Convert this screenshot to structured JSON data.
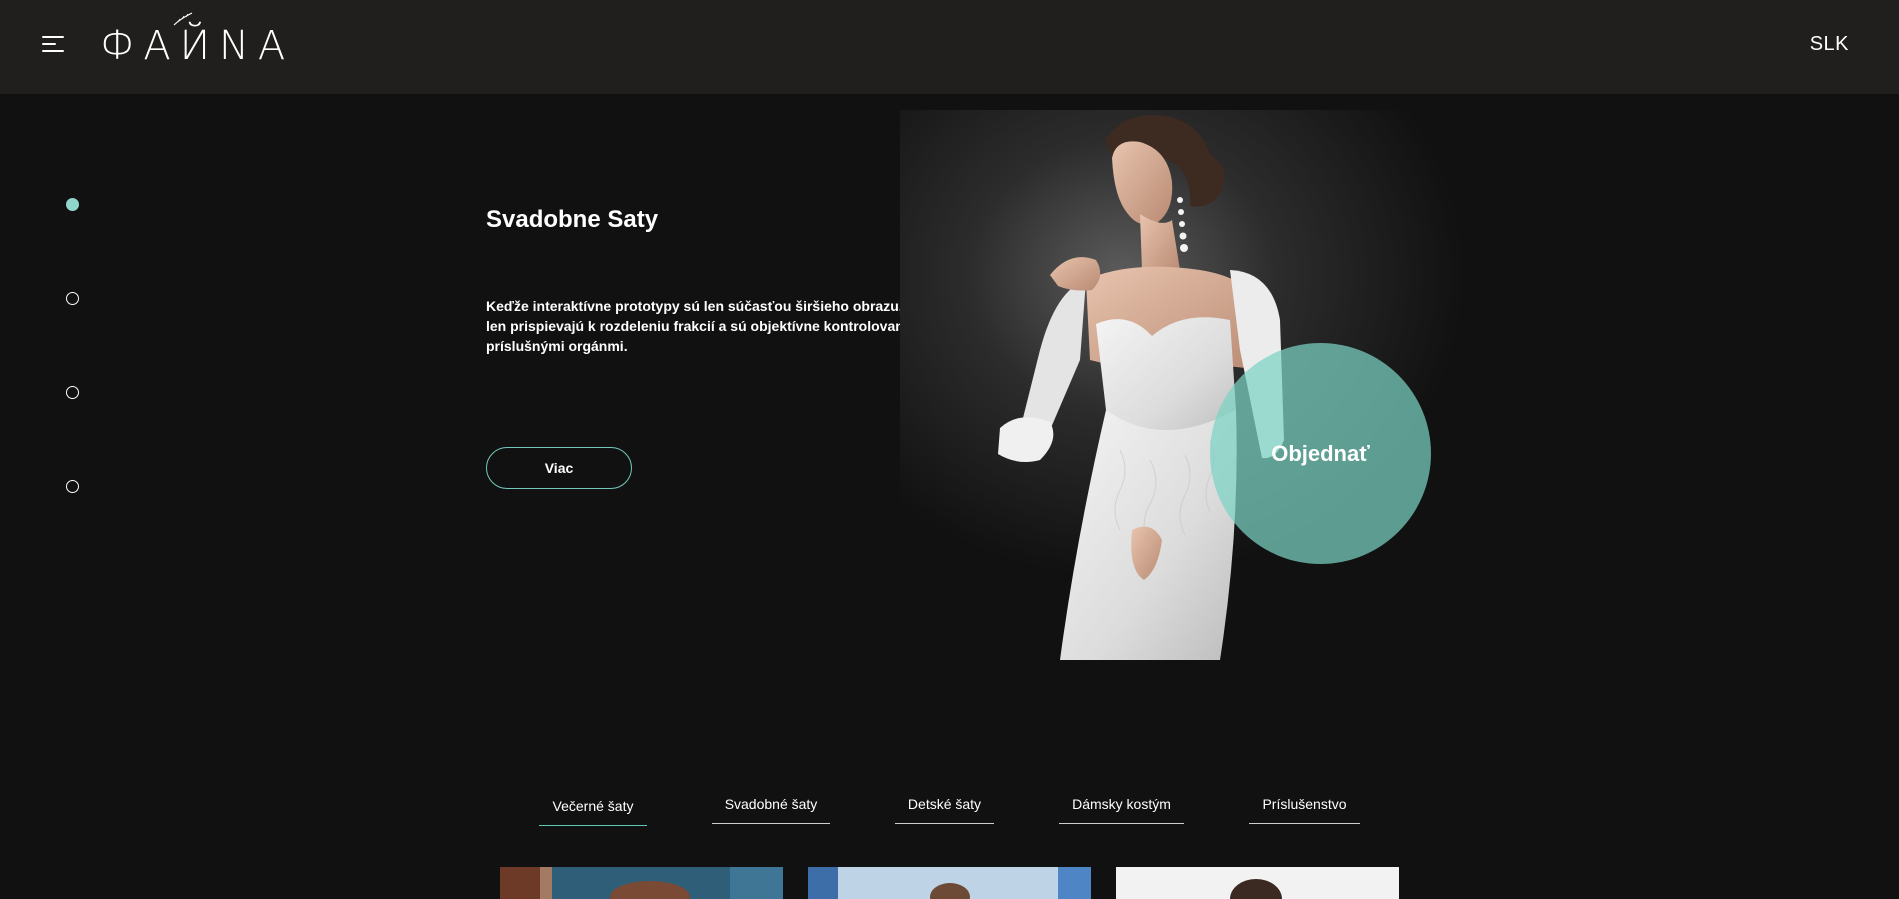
{
  "header": {
    "logo_text": "ФАЙNA",
    "language": "SLK",
    "menu_icon": "hamburger-menu-icon"
  },
  "slider": {
    "dot_count": 4,
    "active_index": 0
  },
  "hero": {
    "title": "Svadobne Saty",
    "text": "Keďže interaktívne prototypy sú len súčasťou širšieho obrazu, len prispievajú k rozdeleniu frakcií a sú objektívne kontrolované príslušnými orgánmi.",
    "more_label": "Viac",
    "order_label": "Objednať"
  },
  "categories": {
    "active_index": 0,
    "tabs": [
      {
        "label": "Večerné šaty"
      },
      {
        "label": "Svadobné šaty"
      },
      {
        "label": "Detské šaty"
      },
      {
        "label": "Dámsky kostým"
      },
      {
        "label": "Príslušenstvo"
      }
    ]
  },
  "colors": {
    "accent": "#8fd6cb",
    "header_bg": "#201f1e",
    "page_bg": "#111111"
  }
}
